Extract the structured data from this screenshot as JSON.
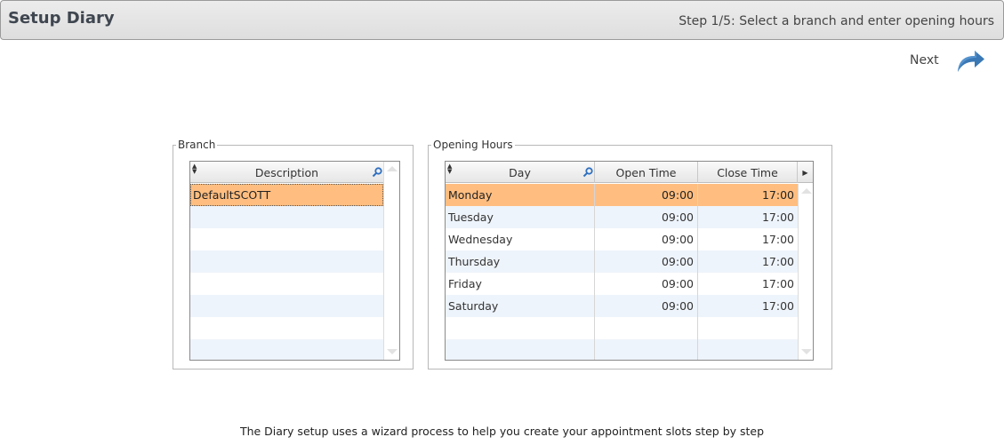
{
  "header": {
    "title": "Setup Diary",
    "step": "Step 1/5: Select a branch and enter opening hours"
  },
  "next_button": {
    "label": "Next",
    "icon": "redo-arrow-icon",
    "icon_color": "#3a78b5"
  },
  "branch": {
    "legend": "Branch",
    "columns": [
      "Description"
    ],
    "rows": [
      "DefaultSCOTT"
    ],
    "selected_index": 0
  },
  "opening_hours": {
    "legend": "Opening Hours",
    "columns": [
      "Day",
      "Open Time",
      "Close Time"
    ],
    "rows": [
      {
        "day": "Monday",
        "open": "09:00",
        "close": "17:00"
      },
      {
        "day": "Tuesday",
        "open": "09:00",
        "close": "17:00"
      },
      {
        "day": "Wednesday",
        "open": "09:00",
        "close": "17:00"
      },
      {
        "day": "Thursday",
        "open": "09:00",
        "close": "17:00"
      },
      {
        "day": "Friday",
        "open": "09:00",
        "close": "17:00"
      },
      {
        "day": "Saturday",
        "open": "09:00",
        "close": "17:00"
      }
    ],
    "selected_index": 0
  },
  "colors": {
    "selected_row": "#ffbe80",
    "alt_row": "#eef4fb"
  },
  "footer": "The Diary setup uses a wizard process to help you create your appointment slots step by step"
}
